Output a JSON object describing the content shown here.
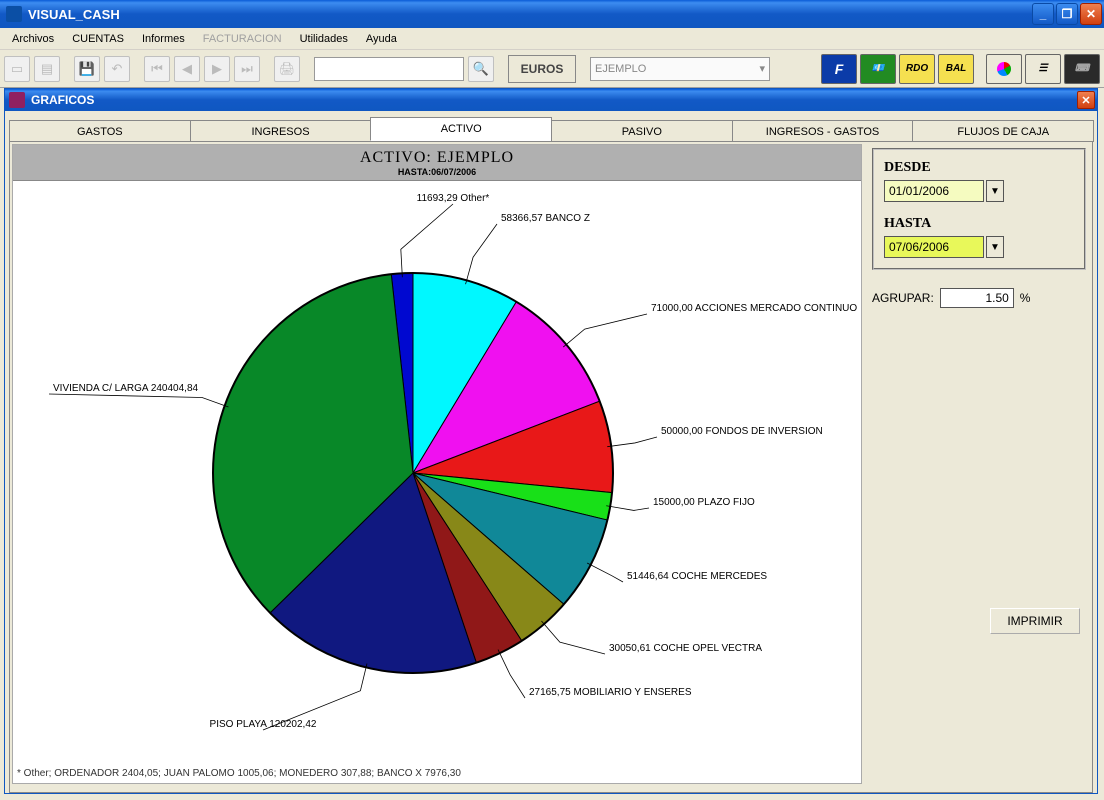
{
  "app": {
    "title": "VISUAL_CASH"
  },
  "menu": {
    "items": [
      "Archivos",
      "CUENTAS",
      "Informes",
      "FACTURACION",
      "Utilidades",
      "Ayuda"
    ],
    "disabled_index": 3
  },
  "toolbar": {
    "euros_label": "EUROS",
    "combo_value": "EJEMPLO",
    "rdo_label": "RDO",
    "bal_label": "BAL"
  },
  "child_window": {
    "title": "GRAFICOS"
  },
  "tabs": {
    "items": [
      "GASTOS",
      "INGRESOS",
      "ACTIVO",
      "PASIVO",
      "INGRESOS - GASTOS",
      "FLUJOS DE CAJA"
    ],
    "active_index": 2
  },
  "chart": {
    "title": "ACTIVO: EJEMPLO",
    "subtitle": "HASTA:06/07/2006",
    "footnote": "* Other; ORDENADOR 2404,05; JUAN PALOMO 1005,06; MONEDERO 307,88; BANCO X 7976,30"
  },
  "side": {
    "desde_label": "DESDE",
    "desde_value": "01/01/2006",
    "hasta_label": "HASTA",
    "hasta_value": "07/06/2006",
    "agrupar_label": "AGRUPAR:",
    "agrupar_value": "1.50",
    "agrupar_pct": "%",
    "print_label": "IMPRIMIR"
  },
  "chart_data": {
    "type": "pie",
    "title": "ACTIVO: EJEMPLO",
    "subtitle": "HASTA:06/07/2006",
    "series": [
      {
        "name": "Other*",
        "value": 11693.29,
        "color": "#0008d0"
      },
      {
        "name": "BANCO Z",
        "value": 58366.57,
        "color": "#00f8ff"
      },
      {
        "name": "ACCIONES MERCADO CONTINUO",
        "value": 71000.0,
        "color": "#f010f0"
      },
      {
        "name": "FONDOS DE INVERSION",
        "value": 50000.0,
        "color": "#e81818"
      },
      {
        "name": "PLAZO FIJO",
        "value": 15000.0,
        "color": "#18e018"
      },
      {
        "name": "COCHE MERCEDES",
        "value": 51446.64,
        "color": "#108898"
      },
      {
        "name": "COCHE OPEL VECTRA",
        "value": 30050.61,
        "color": "#888818"
      },
      {
        "name": "MOBILIARIO Y ENSERES",
        "value": 27165.75,
        "color": "#901818"
      },
      {
        "name": "PISO PLAYA",
        "value": 120202.42,
        "color": "#101880"
      },
      {
        "name": "VIVIENDA C/ LARGA",
        "value": 240404.84,
        "color": "#088828"
      }
    ],
    "other_breakdown": [
      {
        "name": "ORDENADOR",
        "value": 2404.05
      },
      {
        "name": "JUAN PALOMO",
        "value": 1005.06
      },
      {
        "name": "MONEDERO",
        "value": 307.88
      },
      {
        "name": "BANCO X",
        "value": 7976.3
      }
    ],
    "label_format": "value name"
  }
}
